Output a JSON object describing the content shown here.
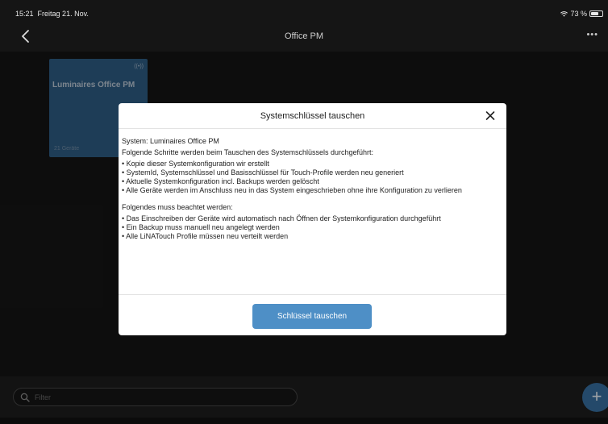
{
  "status_bar": {
    "time": "15:21",
    "date": "Freitag 21. Nov.",
    "battery": "73 %",
    "battery_level": 0.73
  },
  "nav": {
    "title": "Office PM",
    "more_label": "•••",
    "back_icon": "chevron-left-icon"
  },
  "tile": {
    "name": "Luminaires Office PM",
    "wireless_glyph": "((•))",
    "count": "21 Geräte"
  },
  "dialog": {
    "title": "Systemschlüssel tauschen",
    "system_line": "System: Luminaires Office PM",
    "intro": "Folgende Schritte werden beim Tauschen des Systemschlüssels durchgeführt:",
    "steps": [
      "Kopie dieser Systemkonfiguration wir erstellt",
      "SystemId, Systemschlüssel und Basisschlüssel für Touch-Profile werden neu generiert",
      "Aktuelle Systemkonfiguration incl. Backups werden gelöscht",
      "Alle Geräte werden im Anschluss neu in das System eingeschrieben ohne ihre Konfiguration zu verlieren"
    ],
    "notes_heading": "Folgendes muss beachtet werden:",
    "notes": [
      "Das Einschreiben der Geräte wird automatisch nach Öffnen der Systemkonfiguration durchgeführt",
      "Ein Backup muss manuell neu angelegt werden",
      "Alle LiNATouch Profile müssen neu verteilt werden"
    ],
    "primary_button": "Schlüssel tauschen"
  },
  "bottom": {
    "filter_placeholder": "Filter",
    "add_label": "+"
  },
  "colors": {
    "accent": "#4e8fc6",
    "tile": "#2d5a80",
    "fab": "#356c9c"
  }
}
